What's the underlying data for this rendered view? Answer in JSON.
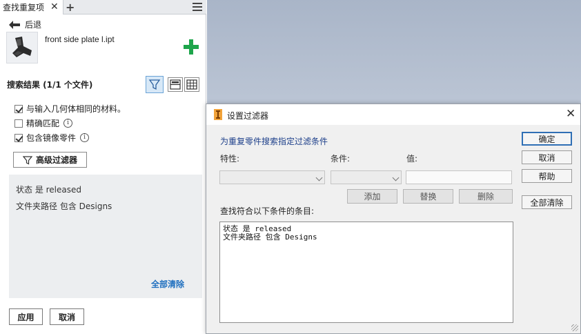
{
  "panel": {
    "tab_label": "查找重复项",
    "back_label": "后退",
    "filename": "front side plate l.ipt",
    "results_label": "搜索结果 (1/1 个文件)",
    "checkboxes": [
      {
        "label": "与输入几何体相同的材料。",
        "checked": true
      },
      {
        "label": "精确匹配",
        "checked": false
      },
      {
        "label": "包含镜像零件",
        "checked": true
      }
    ],
    "info_glyph": "i",
    "advanced_filter": "高级过滤器",
    "filters": [
      "状态 是 released",
      "文件夹路径 包含 Designs"
    ],
    "clear_all": "全部清除",
    "apply": "应用",
    "cancel": "取消"
  },
  "dialog": {
    "title": "设置过滤器",
    "heading": "为重复零件搜索指定过滤条件",
    "property_label": "特性:",
    "condition_label": "条件:",
    "value_label": "值:",
    "add": "添加",
    "replace": "替换",
    "delete": "删除",
    "list_label": "查找符合以下条件的条目:",
    "list_items": [
      "状态 是 released",
      "文件夹路径 包含 Designs"
    ],
    "ok": "确定",
    "cancel": "取消",
    "help": "帮助",
    "clear_all": "全部清除"
  },
  "colors": {
    "accent_blue": "#1f6fbf",
    "add_green": "#1ea54b",
    "heading_navy": "#1d3f8a"
  }
}
